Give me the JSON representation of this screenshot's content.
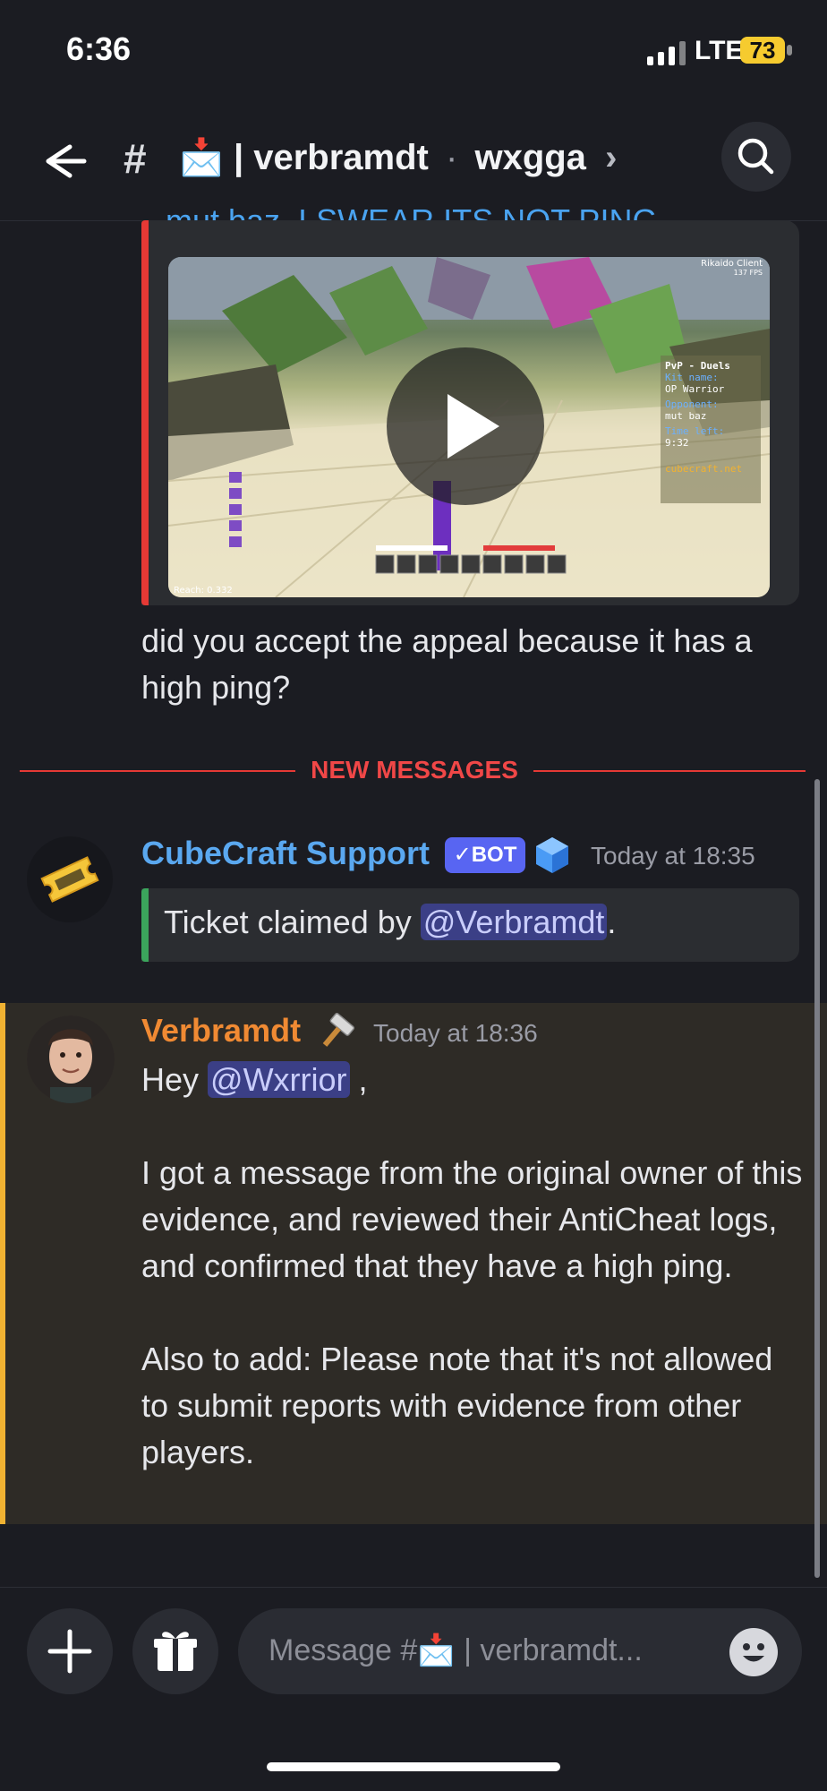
{
  "status": {
    "time": "6:36",
    "network": "LTE",
    "battery": "73"
  },
  "header": {
    "hash": "#",
    "channel_emoji": "📩",
    "channel_name": "| verbramdt",
    "separator": "·",
    "channel_sub": "wxgga",
    "chevron": "›"
  },
  "messages": {
    "embed_cut_text": "mut baz, I SWEAR ITS NOT PING",
    "question": "did you accept the appeal because it has a high ping?",
    "new_messages_label": "NEW MESSAGES",
    "bot": {
      "name": "CubeCraft Support",
      "badge": "✓BOT",
      "time": "Today at 18:35",
      "embed_prefix": "Ticket claimed by ",
      "embed_mention": "@Verbramdt",
      "embed_suffix": "."
    },
    "user": {
      "name": "Verbramdt",
      "time": "Today at 18:36",
      "greeting": "Hey ",
      "mention": "@Wxrrior",
      "greeting_suffix": " ,",
      "para1": "I got a message from the original owner of this evidence, and reviewed their AntiCheat logs, and confirmed that they have a high ping.",
      "para2": "Also to add: Please note that it's not allowed to submit reports with evidence from other players."
    }
  },
  "video": {
    "hud_title": "PvP - Duels",
    "kit_label": "Kit name:",
    "kit_value": "OP Warrior",
    "opponent_label": "Opponent:",
    "opponent_value": "mut baz",
    "time_label": "Time left:",
    "time_value": "9:32",
    "server": "cubecraft.net",
    "client": "Rikaido Client",
    "fps": "137 FPS",
    "reach": "Reach: 0.332"
  },
  "composer": {
    "placeholder": "Message #📩 | verbramdt..."
  },
  "colors": {
    "accent_red": "#e53935",
    "mention_bg": "#3b3f86",
    "highlight_bar": "#f0b232"
  }
}
